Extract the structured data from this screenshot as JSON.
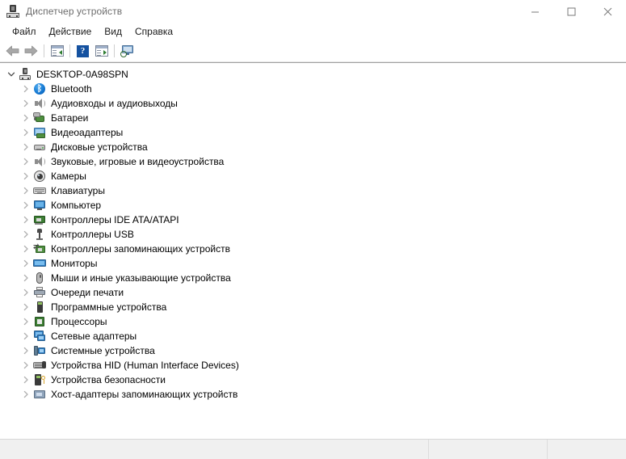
{
  "window": {
    "title": "Диспетчер устройств",
    "icon": "device-manager-icon",
    "minimize_label": "—",
    "maximize_label": "☐",
    "close_label": "✕"
  },
  "menubar": {
    "items": [
      {
        "label": "Файл",
        "name": "menu-file"
      },
      {
        "label": "Действие",
        "name": "menu-action"
      },
      {
        "label": "Вид",
        "name": "menu-view"
      },
      {
        "label": "Справка",
        "name": "menu-help"
      }
    ]
  },
  "toolbar": {
    "buttons": [
      {
        "name": "back-arrow-icon",
        "title": "Назад"
      },
      {
        "name": "forward-arrow-icon",
        "title": "Вперед"
      },
      {
        "name": "properties-icon",
        "title": "Свойства"
      },
      {
        "name": "help-icon",
        "title": "Справка"
      },
      {
        "name": "show-hidden-devices-icon",
        "title": "Показать скрытые устройства"
      },
      {
        "name": "scan-hardware-changes-icon",
        "title": "Обновить конфигурацию оборудования"
      }
    ]
  },
  "tree": {
    "root": {
      "label": "DESKTOP-0A98SPN",
      "icon": "computer-root-icon",
      "expanded": true,
      "chevron": "chevron-down-icon"
    },
    "children": [
      {
        "label": "Bluetooth",
        "icon": "bluetooth-icon",
        "chevron": "chevron-right-icon"
      },
      {
        "label": "Аудиовходы и аудиовыходы",
        "icon": "audio-icon",
        "chevron": "chevron-right-icon"
      },
      {
        "label": "Батареи",
        "icon": "battery-icon",
        "chevron": "chevron-right-icon"
      },
      {
        "label": "Видеоадаптеры",
        "icon": "display-adapter-icon",
        "chevron": "chevron-right-icon"
      },
      {
        "label": "Дисковые устройства",
        "icon": "disk-drive-icon",
        "chevron": "chevron-right-icon"
      },
      {
        "label": "Звуковые, игровые и видеоустройства",
        "icon": "sound-video-game-icon",
        "chevron": "chevron-right-icon"
      },
      {
        "label": "Камеры",
        "icon": "camera-icon",
        "chevron": "chevron-right-icon"
      },
      {
        "label": "Клавиатуры",
        "icon": "keyboard-icon",
        "chevron": "chevron-right-icon"
      },
      {
        "label": "Компьютер",
        "icon": "computer-icon",
        "chevron": "chevron-right-icon"
      },
      {
        "label": "Контроллеры IDE ATA/ATAPI",
        "icon": "ide-controller-icon",
        "chevron": "chevron-right-icon"
      },
      {
        "label": "Контроллеры USB",
        "icon": "usb-controller-icon",
        "chevron": "chevron-right-icon"
      },
      {
        "label": "Контроллеры запоминающих устройств",
        "icon": "storage-controller-icon",
        "chevron": "chevron-right-icon"
      },
      {
        "label": "Мониторы",
        "icon": "monitor-icon",
        "chevron": "chevron-right-icon"
      },
      {
        "label": "Мыши и иные указывающие устройства",
        "icon": "mouse-icon",
        "chevron": "chevron-right-icon"
      },
      {
        "label": "Очереди печати",
        "icon": "printer-icon",
        "chevron": "chevron-right-icon"
      },
      {
        "label": "Программные устройства",
        "icon": "software-device-icon",
        "chevron": "chevron-right-icon"
      },
      {
        "label": "Процессоры",
        "icon": "processor-icon",
        "chevron": "chevron-right-icon"
      },
      {
        "label": "Сетевые адаптеры",
        "icon": "network-adapter-icon",
        "chevron": "chevron-right-icon"
      },
      {
        "label": "Системные устройства",
        "icon": "system-device-icon",
        "chevron": "chevron-right-icon"
      },
      {
        "label": "Устройства HID (Human Interface Devices)",
        "icon": "hid-device-icon",
        "chevron": "chevron-right-icon"
      },
      {
        "label": "Устройства безопасности",
        "icon": "security-device-icon",
        "chevron": "chevron-right-icon"
      },
      {
        "label": "Хост-адаптеры запоминающих устройств",
        "icon": "host-adapter-icon",
        "chevron": "chevron-right-icon"
      }
    ]
  },
  "statusbar": {
    "cell1": "",
    "cell2": "",
    "cell3": ""
  },
  "colors": {
    "window_bg": "#ffffff",
    "title_text": "#6d6d6d",
    "menu_text": "#1a1a1a",
    "statusbar_bg": "#f0f0f0",
    "accent_blue": "#1552a0",
    "bluetooth_blue": "#1376d0"
  }
}
